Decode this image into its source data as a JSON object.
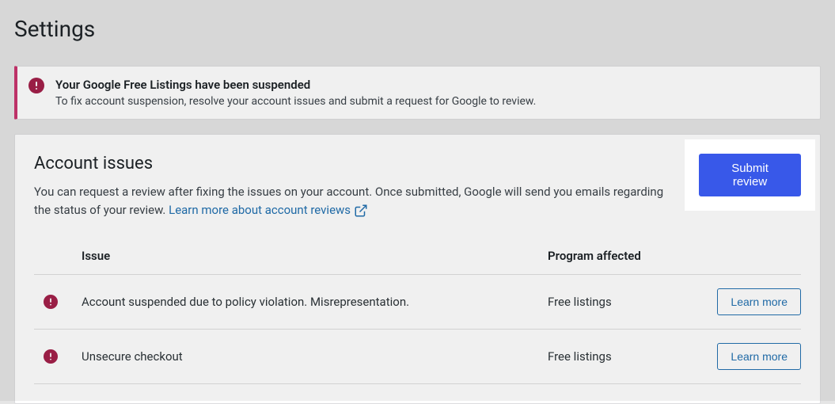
{
  "page": {
    "title": "Settings"
  },
  "alert": {
    "title": "Your Google Free Listings have been suspended",
    "description": "To fix account suspension, resolve your account issues and submit a request for Google to review."
  },
  "panel": {
    "title": "Account issues",
    "description": "You can request a review after fixing the issues on your account. Once submitted, Google will send you emails regarding the status of your review. ",
    "link_text": "Learn more about account reviews",
    "submit_label": "Submit review"
  },
  "table": {
    "headers": {
      "issue": "Issue",
      "program": "Program affected"
    },
    "rows": [
      {
        "issue": "Account suspended due to policy violation. Misrepresentation.",
        "program": "Free listings",
        "action": "Learn more"
      },
      {
        "issue": "Unsecure checkout",
        "program": "Free listings",
        "action": "Learn more"
      }
    ]
  }
}
